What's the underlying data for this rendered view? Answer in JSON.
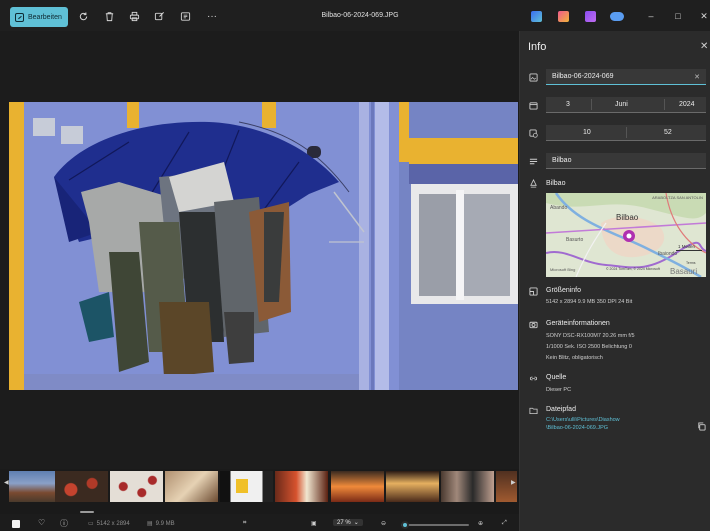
{
  "toolbar": {
    "edit_label": "Bearbeiten",
    "file_name": "Bilbao-06-2024-069.JPG"
  },
  "info_panel": {
    "title": "Info",
    "name_value": "Bilbao-06-2024-069",
    "date": {
      "day": "3",
      "month": "Juni",
      "year": "2024"
    },
    "time": {
      "hour": "10",
      "minute": "52"
    },
    "caption_value": "Bilbao",
    "location": "Bilbao",
    "map": {
      "city_label": "Bilbao",
      "places": [
        "Abando",
        "Basurto",
        "Ibaiondo",
        "ARABOLTZA SAN ANTOLIN"
      ],
      "scale": "1 Meilen",
      "copyright": "© 2024 TomTom, © 2024 Microsoft",
      "terms": "Terms",
      "provider": "Microsoft Bing",
      "corner_place": "Basauri"
    },
    "size": {
      "label": "Größeninfo",
      "details": "5142 x 2894   9.9 MB   350 DPI   24 Bit"
    },
    "device": {
      "label": "Geräteinformationen",
      "line1": "SONY   DSC-RX100M7   20.26 mm   f/5",
      "line2": "1/1000 Sek.   ISO 2500   Belichtung 0",
      "line3": "Kein Blitz, obligatorisch"
    },
    "source": {
      "label": "Quelle",
      "value": "Dieser PC"
    },
    "path": {
      "label": "Dateipfad",
      "line1": "C:\\Users\\ulli\\Pictures\\Diashow",
      "line2": "\\Bilbao-06-2024-069.JPG"
    }
  },
  "statusbar": {
    "dimensions": "5142 x 2894",
    "filesize": "9.9 MB",
    "zoom_label": "27 %",
    "zoom_level": 0.03
  },
  "colors": {
    "accent": "#5fc0d6",
    "panel_bg": "#2b2b2b",
    "window_bg": "#1c1c1c"
  },
  "icons": [
    "pen-icon",
    "rotate-icon",
    "delete-icon",
    "print-icon",
    "edit-icon",
    "slideshow-icon",
    "more-icon",
    "minimize-icon",
    "maximize-icon",
    "close-icon",
    "image-icon",
    "calendar-icon",
    "camera-icon",
    "caption-icon",
    "location-icon",
    "size-icon",
    "device-icon",
    "link-icon",
    "folder-icon",
    "copy-icon",
    "heart-icon",
    "info-icon",
    "zoom-in-icon",
    "zoom-out-icon",
    "fullscreen-icon"
  ]
}
